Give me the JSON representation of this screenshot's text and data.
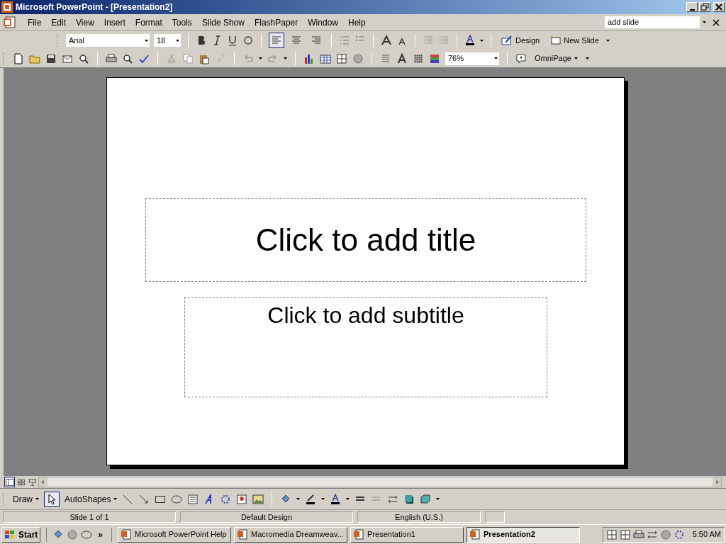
{
  "window": {
    "title": "Microsoft PowerPoint - [Presentation2]"
  },
  "menu": [
    {
      "label": "File"
    },
    {
      "label": "Edit"
    },
    {
      "label": "View"
    },
    {
      "label": "Insert"
    },
    {
      "label": "Format"
    },
    {
      "label": "Tools"
    },
    {
      "label": "Slide Show"
    },
    {
      "label": "FlashPaper"
    },
    {
      "label": "Window"
    },
    {
      "label": "Help"
    }
  ],
  "help_search": {
    "value": "add slide"
  },
  "formatting_toolbar": {
    "font": "Arial",
    "size": "18",
    "align_buttons": [
      {
        "selected": true
      },
      {
        "selected": false
      },
      {
        "selected": false
      }
    ],
    "design": "Design",
    "new_slide": "New Slide"
  },
  "standard_toolbar": {
    "zoom": "76%",
    "omnipage": "OmniPage"
  },
  "slide": {
    "title_placeholder": "Click to add title",
    "subtitle_placeholder": "Click to add subtitle"
  },
  "view_buttons": [
    {
      "selected": true
    },
    {
      "selected": false
    },
    {
      "selected": false
    }
  ],
  "drawing_toolbar": {
    "draw": "Draw",
    "select_tool": {
      "selected": true
    },
    "autoshapes": "AutoShapes"
  },
  "status_bar": [
    "Slide 1 of 1",
    "Default Design",
    "English (U.S.)"
  ],
  "taskbar": {
    "start": "Start",
    "chevron": "»",
    "tasks": [
      {
        "label": "Microsoft PowerPoint Help",
        "selected": false
      },
      {
        "label": "Macromedia Dreamweav...",
        "selected": false
      },
      {
        "label": "Presentation1",
        "selected": false
      },
      {
        "label": "Presentation2",
        "selected": true
      }
    ],
    "clock": "5:50 AM"
  }
}
